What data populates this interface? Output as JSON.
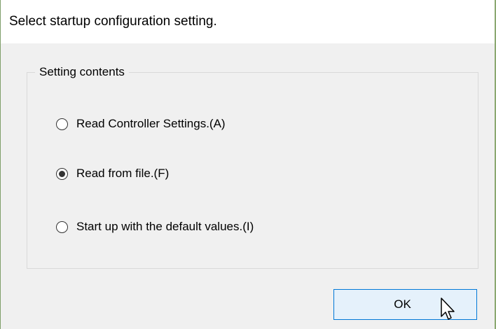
{
  "dialog": {
    "title": "Select startup configuration setting."
  },
  "group": {
    "legend": "Setting contents",
    "options": [
      {
        "label": "Read Controller Settings.(A)",
        "checked": false
      },
      {
        "label": "Read from file.(F)",
        "checked": true
      },
      {
        "label": "Start up with the default values.(I)",
        "checked": false
      }
    ]
  },
  "buttons": {
    "ok_label": "OK"
  },
  "colors": {
    "button_border": "#0078d7",
    "button_fill": "#e5f1fb",
    "window_border": "#7f9f6a"
  },
  "icons": {
    "cursor": "mouse-pointer-icon"
  }
}
